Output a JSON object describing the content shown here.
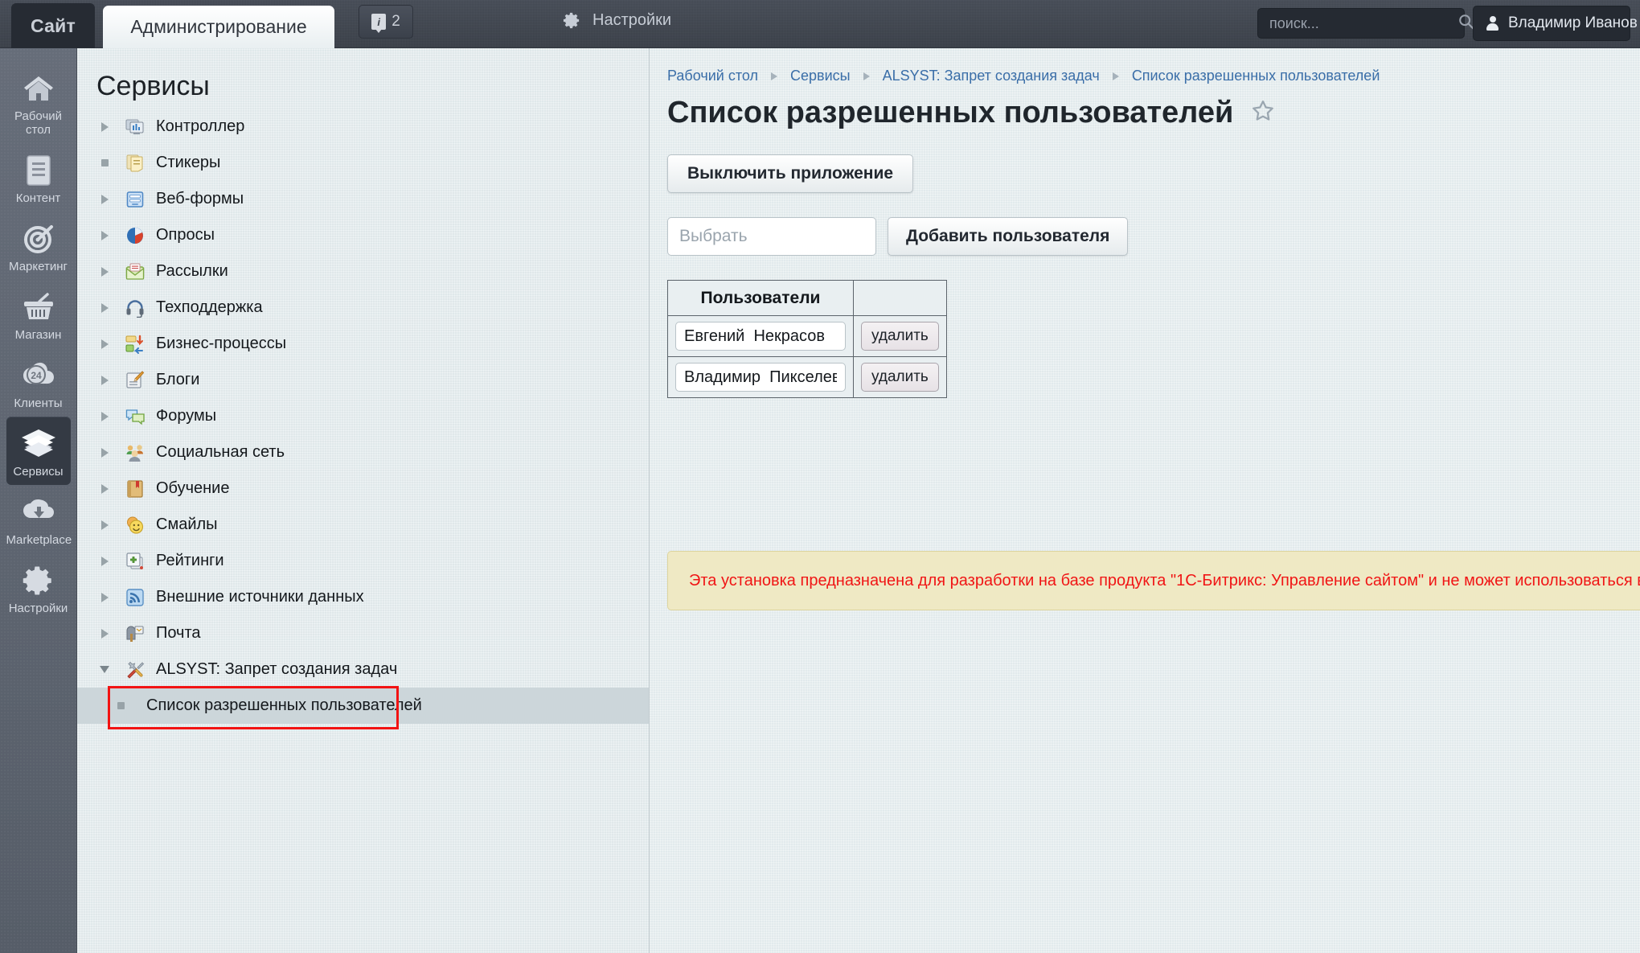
{
  "topbar": {
    "site_tab": "Сайт",
    "admin_tab": "Администрирование",
    "counter_value": "2",
    "counter_icon": "info-icon",
    "settings_label": "Настройки",
    "settings_icon": "gear-icon",
    "search_placeholder": "поиск...",
    "search_value": "",
    "search_icon": "search-icon",
    "user_name": "Владимир Иванов",
    "user_icon": "person-icon"
  },
  "rail": {
    "items": [
      {
        "label": "Рабочий стол",
        "icon": "home-icon",
        "active": false
      },
      {
        "label": "Контент",
        "icon": "document-icon",
        "active": false
      },
      {
        "label": "Маркетинг",
        "icon": "target-icon",
        "active": false
      },
      {
        "label": "Магазин",
        "icon": "basket-icon",
        "active": false
      },
      {
        "label": "Клиенты",
        "icon": "cloud24-icon",
        "active": false
      },
      {
        "label": "Сервисы",
        "icon": "layers-icon",
        "active": true
      },
      {
        "label": "Marketplace",
        "icon": "cloud-download-icon",
        "active": false
      },
      {
        "label": "Настройки",
        "icon": "gear-icon",
        "active": false
      }
    ]
  },
  "tree": {
    "title": "Сервисы",
    "items": [
      {
        "label": "Контроллер",
        "marker": "arrow-right",
        "icon": "controller-icon",
        "selected": false,
        "sub": false
      },
      {
        "label": "Стикеры",
        "marker": "dot",
        "icon": "sticker-icon",
        "selected": false,
        "sub": false
      },
      {
        "label": "Веб-формы",
        "marker": "arrow-right",
        "icon": "webform-icon",
        "selected": false,
        "sub": false
      },
      {
        "label": "Опросы",
        "marker": "arrow-right",
        "icon": "poll-icon",
        "selected": false,
        "sub": false
      },
      {
        "label": "Рассылки",
        "marker": "arrow-right",
        "icon": "mail-envelope-icon",
        "selected": false,
        "sub": false
      },
      {
        "label": "Техподдержка",
        "marker": "arrow-right",
        "icon": "headset-icon",
        "selected": false,
        "sub": false
      },
      {
        "label": "Бизнес-процессы",
        "marker": "arrow-right",
        "icon": "bizproc-icon",
        "selected": false,
        "sub": false
      },
      {
        "label": "Блоги",
        "marker": "arrow-right",
        "icon": "blog-pencil-icon",
        "selected": false,
        "sub": false
      },
      {
        "label": "Форумы",
        "marker": "arrow-right",
        "icon": "forum-bubbles-icon",
        "selected": false,
        "sub": false
      },
      {
        "label": "Социальная сеть",
        "marker": "arrow-right",
        "icon": "people-icon",
        "selected": false,
        "sub": false
      },
      {
        "label": "Обучение",
        "marker": "arrow-right",
        "icon": "book-icon",
        "selected": false,
        "sub": false
      },
      {
        "label": "Смайлы",
        "marker": "arrow-right",
        "icon": "smiley-icon",
        "selected": false,
        "sub": false
      },
      {
        "label": "Рейтинги",
        "marker": "arrow-right",
        "icon": "rating-plus-icon",
        "selected": false,
        "sub": false
      },
      {
        "label": "Внешние источники данных",
        "marker": "arrow-right",
        "icon": "rss-icon",
        "selected": false,
        "sub": false
      },
      {
        "label": "Почта",
        "marker": "arrow-right",
        "icon": "mailbox-icon",
        "selected": false,
        "sub": false
      },
      {
        "label": "ALSYST: Запрет создания задач",
        "marker": "arrow-down",
        "icon": "tools-icon",
        "selected": false,
        "sub": false
      },
      {
        "label": "Список разрешенных пользователей",
        "marker": "dot",
        "icon": "none",
        "selected": true,
        "sub": true
      }
    ]
  },
  "main": {
    "breadcrumb": [
      "Рабочий стол",
      "Сервисы",
      "ALSYST: Запрет создания задач",
      "Список разрешенных пользователей"
    ],
    "page_title": "Список разрешенных пользователей",
    "favorite_icon": "star-outline-icon",
    "disable_button": "Выключить приложение",
    "select_placeholder": "Выбрать",
    "select_value": "",
    "add_button": "Добавить пользователя",
    "table": {
      "headers": [
        "Пользователи",
        ""
      ],
      "rows": [
        {
          "user": "Евгений  Некрасов",
          "action": "удалить"
        },
        {
          "user": "Владимир  Пикселев",
          "action": "удалить"
        }
      ]
    },
    "notice": "Эта установка предназначена для разработки на базе продукта \"1С-Битрикс: Управление сайтом\" и не может использоваться в качестве рабочего (боевого) сайта."
  },
  "colors": {
    "topbar_bg": "#3e444e",
    "rail_bg": "#5d646f",
    "panel_bg": "#e0e8ea",
    "accent_link": "#3a6ea8",
    "notice_bg": "#efe9c4",
    "notice_text": "#f01515",
    "highlight_box": "#f21313",
    "selected_row": "#ccd6da"
  }
}
